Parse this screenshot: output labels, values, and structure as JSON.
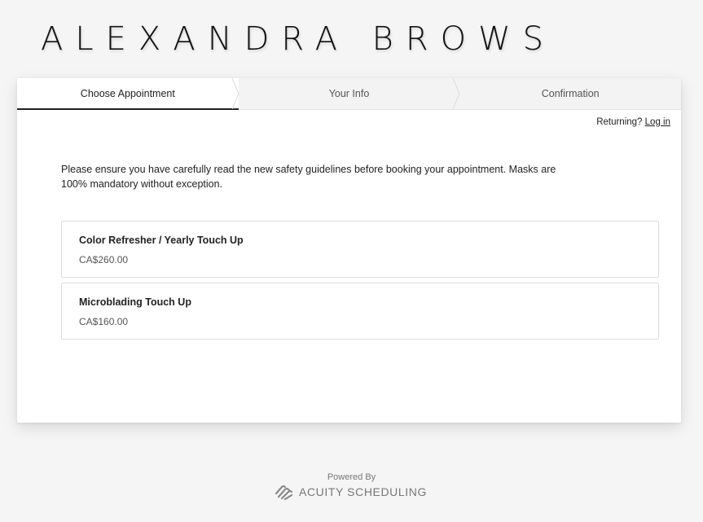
{
  "brand": {
    "name": "ALEXANDRA BROWS"
  },
  "steps": [
    {
      "label": "Choose Appointment"
    },
    {
      "label": "Your Info"
    },
    {
      "label": "Confirmation"
    }
  ],
  "returning": {
    "text": "Returning?",
    "link": "Log in"
  },
  "notice": "Please ensure you have carefully read the new safety guidelines before booking your appointment. Masks are 100% mandatory without exception.",
  "services": [
    {
      "name": "Color Refresher / Yearly Touch Up",
      "price": "CA$260.00"
    },
    {
      "name": "Microblading Touch Up",
      "price": "CA$160.00"
    }
  ],
  "footer": {
    "powered_by": "Powered By",
    "provider": "ACUITY SCHEDULING",
    "logo_icon": "acuity-logo-icon"
  }
}
